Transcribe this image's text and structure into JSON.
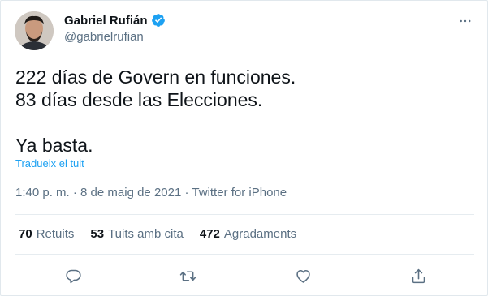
{
  "author": {
    "display_name": "Gabriel Rufián",
    "handle": "@gabrielrufian"
  },
  "tweet": {
    "lines": [
      "222 días de Govern en funciones.",
      "83 días desde las Elecciones.",
      "",
      "Ya basta."
    ],
    "translate_link": "Tradueix el tuit"
  },
  "meta": {
    "time": "1:40 p. m.",
    "separator1": " · ",
    "date": "8 de maig de 2021",
    "separator2": " · ",
    "source": "Twitter for iPhone"
  },
  "stats": {
    "retweets_count": "70",
    "retweets_label": "Retuits",
    "quotes_count": "53",
    "quotes_label": "Tuits amb cita",
    "likes_count": "472",
    "likes_label": "Agradaments"
  },
  "icons": {
    "verified": "verified-badge-icon",
    "more": "more-options-icon",
    "reply": "reply-icon",
    "retweet": "retweet-icon",
    "like": "like-icon",
    "share": "share-icon"
  },
  "colors": {
    "verified": "#1da1f2",
    "link": "#1da1f2",
    "secondary_text": "#5b7083",
    "primary_text": "#0f1419"
  }
}
